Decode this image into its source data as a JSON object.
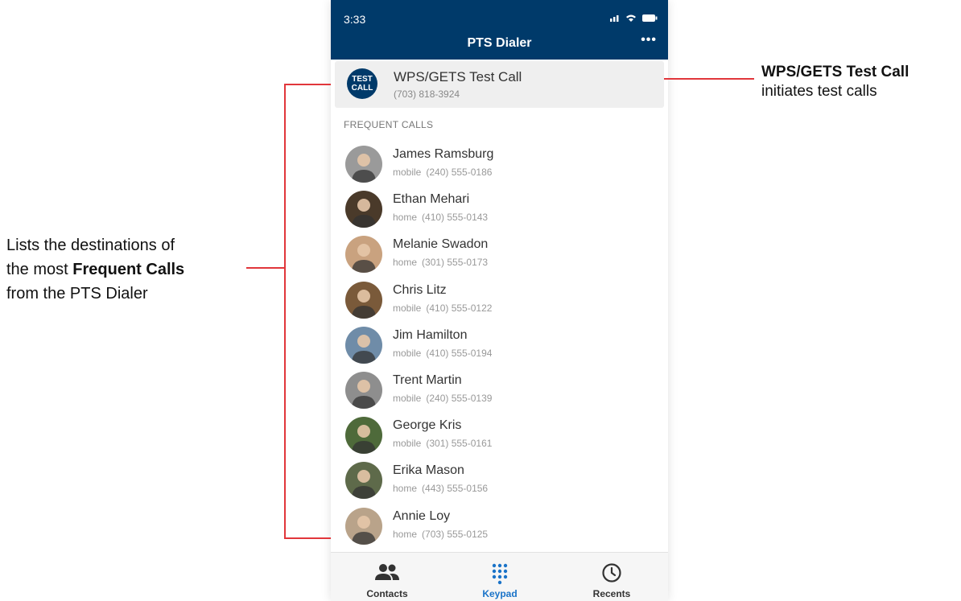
{
  "status_bar": {
    "time": "3:33",
    "icons": "signal-wifi-battery"
  },
  "header": {
    "title": "PTS Dialer",
    "more_label": "•••"
  },
  "test_call": {
    "badge_line1": "TEST",
    "badge_line2": "CALL",
    "name": "WPS/GETS Test Call",
    "number": "(703) 818-3924"
  },
  "section_label": "FREQUENT CALLS",
  "contacts": [
    {
      "name": "James Ramsburg",
      "type": "mobile",
      "number": "(240) 555-0186",
      "color": "#9a9a9a"
    },
    {
      "name": "Ethan Mehari",
      "type": "home",
      "number": "(410) 555-0143",
      "color": "#4a3a2a"
    },
    {
      "name": "Melanie Swadon",
      "type": "home",
      "number": "(301) 555-0173",
      "color": "#c9a27f"
    },
    {
      "name": "Chris Litz",
      "type": "mobile",
      "number": "(410) 555-0122",
      "color": "#7a5a3a"
    },
    {
      "name": "Jim Hamilton",
      "type": "mobile",
      "number": "(410) 555-0194",
      "color": "#6f8ca8"
    },
    {
      "name": "Trent Martin",
      "type": "mobile",
      "number": "(240) 555-0139",
      "color": "#8e8e8e"
    },
    {
      "name": "George Kris",
      "type": "mobile",
      "number": "(301) 555-0161",
      "color": "#4e6a3a"
    },
    {
      "name": "Erika Mason",
      "type": "home",
      "number": "(443) 555-0156",
      "color": "#5e6a4a"
    },
    {
      "name": "Annie Loy",
      "type": "home",
      "number": "(703) 555-0125",
      "color": "#b9a38a"
    }
  ],
  "tabs": [
    {
      "label": "Contacts",
      "icon": "people-icon",
      "active": false
    },
    {
      "label": "Keypad",
      "icon": "keypad-icon",
      "active": true
    },
    {
      "label": "Recents",
      "icon": "clock-icon",
      "active": false
    }
  ],
  "callouts": {
    "right_title": "WPS/GETS Test Call",
    "right_desc": "initiates test calls",
    "left_line1": "Lists the destinations of",
    "left_line2_prefix": "the most ",
    "left_line2_bold": "Frequent Calls",
    "left_line3": "from the PTS Dialer"
  },
  "colors": {
    "header": "#003a6a",
    "accent": "#1a73c8",
    "callout_line": "#e1363b"
  }
}
